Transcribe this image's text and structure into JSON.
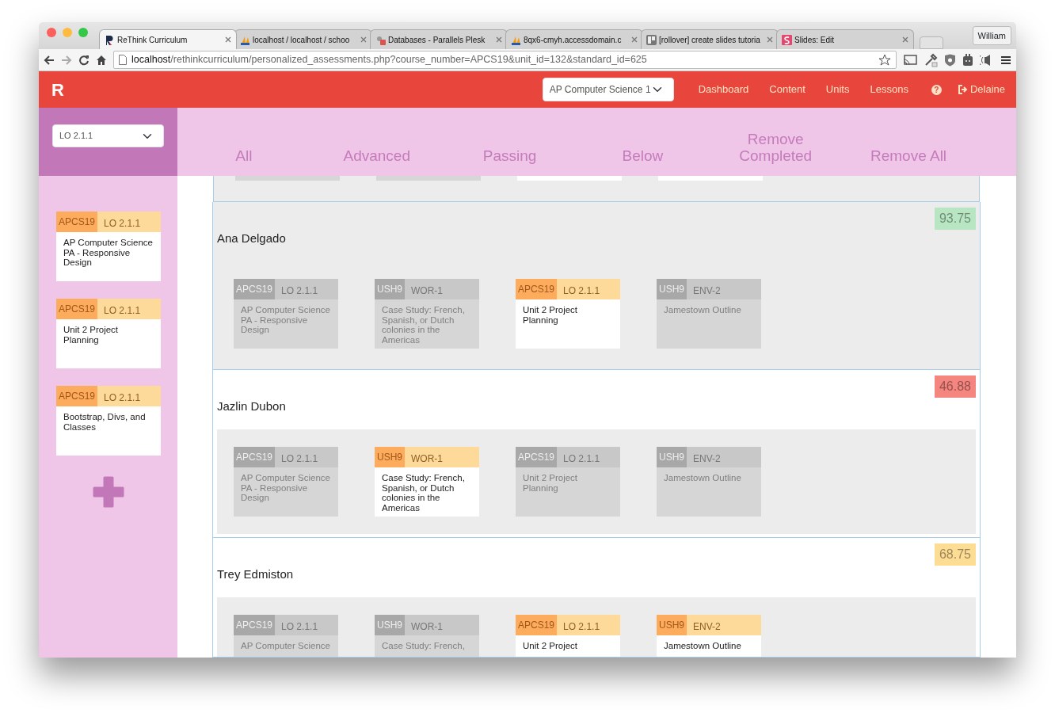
{
  "browser": {
    "tabs": [
      {
        "title": "ReThink Curriculum",
        "selected": true
      },
      {
        "title": "localhost / localhost / schoo",
        "selected": false
      },
      {
        "title": "Databases - Parallels Plesk",
        "selected": false
      },
      {
        "title": "8qx6-cmyh.accessdomain.c",
        "selected": false
      },
      {
        "title": "[rollover] create slides tutoria",
        "selected": false
      },
      {
        "title": "Slides: Edit",
        "selected": false
      }
    ],
    "profile": "William",
    "url_host": "localhost",
    "url_path": "/rethinkcurriculum/personalized_assessments.php?course_number=APCS19&unit_id=132&standard_id=625"
  },
  "navbar": {
    "logo": "R",
    "course_select": "AP Computer Science 1",
    "links": [
      "Dashboard",
      "Content",
      "Units",
      "Lessons"
    ],
    "help": "?",
    "user": "Delaine"
  },
  "sidebar": {
    "objective_select": "LO 2.1.1",
    "cards": [
      {
        "course": "APCS19",
        "code": "LO 2.1.1",
        "title": "AP Computer Science PA - Responsive Design",
        "active": true
      },
      {
        "course": "APCS19",
        "code": "LO 2.1.1",
        "title": "Unit 2 Project Planning",
        "active": true
      },
      {
        "course": "APCS19",
        "code": "LO 2.1.1",
        "title": "Bootstrap, Divs, and Classes",
        "active": true
      }
    ]
  },
  "filters": [
    "All",
    "Advanced",
    "Passing",
    "Below",
    "Remove Completed",
    "Remove All"
  ],
  "previous_cards": [
    {
      "active": false
    },
    {
      "active": false
    },
    {
      "active": true
    },
    {
      "active": true
    }
  ],
  "students": [
    {
      "name": "Ana Delgado",
      "score": "93.75",
      "color": "#b8e6c2",
      "highlighted": true,
      "cards": [
        {
          "course": "APCS19",
          "code": "LO 2.1.1",
          "title": "AP Computer Science PA - Responsive Design",
          "active": false
        },
        {
          "course": "USH9",
          "code": "WOR-1",
          "title": "Case Study: French, Spanish, or Dutch colonies in the Americas",
          "active": false
        },
        {
          "course": "APCS19",
          "code": "LO 2.1.1",
          "title": "Unit 2 Project Planning",
          "active": true
        },
        {
          "course": "USH9",
          "code": "ENV-2",
          "title": "Jamestown Outline",
          "active": false
        }
      ]
    },
    {
      "name": "Jazlin Dubon",
      "score": "46.88",
      "color": "#f4857f",
      "highlighted": false,
      "cards": [
        {
          "course": "APCS19",
          "code": "LO 2.1.1",
          "title": "AP Computer Science PA - Responsive Design",
          "active": false
        },
        {
          "course": "USH9",
          "code": "WOR-1",
          "title": "Case Study: French, Spanish, or Dutch colonies in the Americas",
          "active": true
        },
        {
          "course": "APCS19",
          "code": "LO 2.1.1",
          "title": "Unit 2 Project Planning",
          "active": false
        },
        {
          "course": "USH9",
          "code": "ENV-2",
          "title": "Jamestown Outline",
          "active": false
        }
      ]
    },
    {
      "name": "Trey Edmiston",
      "score": "68.75",
      "color": "#fddc94",
      "highlighted": false,
      "cards": [
        {
          "course": "APCS19",
          "code": "LO 2.1.1",
          "title": "AP Computer Science",
          "active": false
        },
        {
          "course": "USH9",
          "code": "WOR-1",
          "title": "Case Study: French,",
          "active": false
        },
        {
          "course": "APCS19",
          "code": "LO 2.1.1",
          "title": "Unit 2 Project",
          "active": true
        },
        {
          "course": "USH9",
          "code": "ENV-2",
          "title": "Jamestown Outline",
          "active": true
        }
      ]
    }
  ]
}
